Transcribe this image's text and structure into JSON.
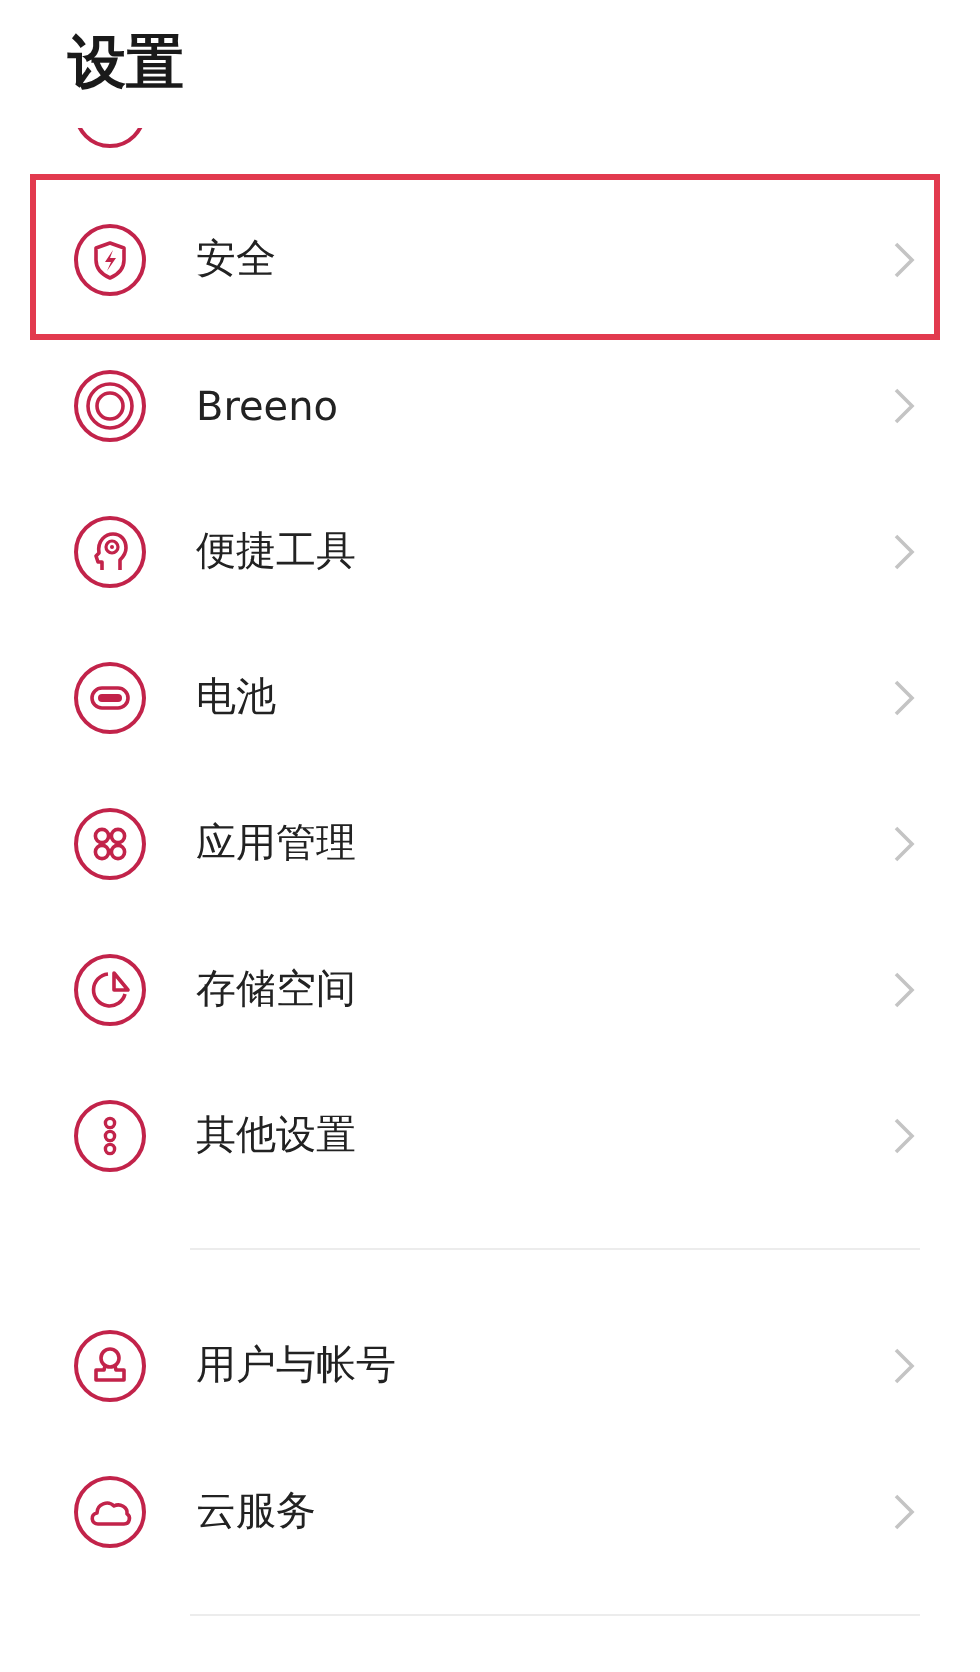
{
  "title": "设置",
  "groups": [
    {
      "items": [
        {
          "label": "安全",
          "highlighted": true
        },
        {
          "label": "Breeno",
          "highlighted": false
        },
        {
          "label": "便捷工具",
          "highlighted": false
        },
        {
          "label": "电池",
          "highlighted": false
        },
        {
          "label": "应用管理",
          "highlighted": false
        },
        {
          "label": "存储空间",
          "highlighted": false
        },
        {
          "label": "其他设置",
          "highlighted": false
        }
      ]
    },
    {
      "items": [
        {
          "label": "用户与帐号",
          "highlighted": false
        },
        {
          "label": "云服务",
          "highlighted": false
        }
      ]
    }
  ]
}
